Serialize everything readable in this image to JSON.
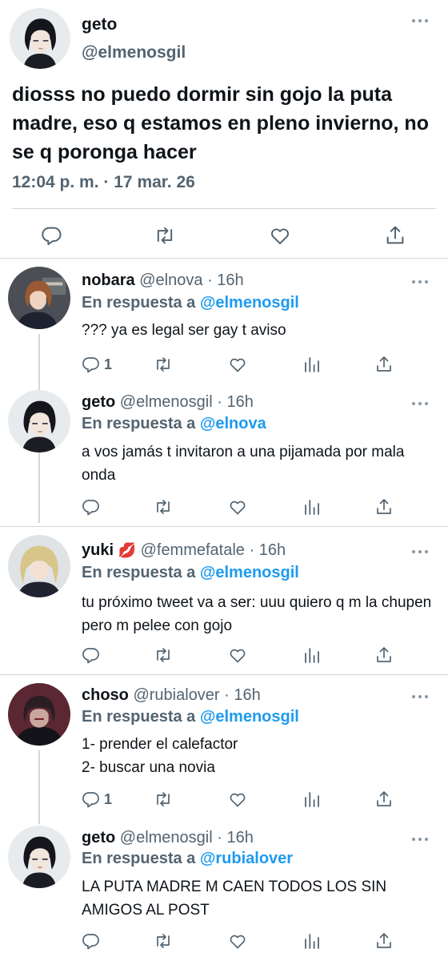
{
  "main_tweet": {
    "name": "geto",
    "handle": "@elmenosgil",
    "text": "diosss no puedo dormir sin gojo la puta madre, eso q estamos en pleno invierno, no se q poronga hacer",
    "time": "12:04 p. m.",
    "separator": "·",
    "date": "17 mar. 26"
  },
  "reply_prefix": "En respuesta a",
  "replies": [
    {
      "name": "nobara",
      "handle": "@elnova",
      "time": "16h",
      "to": "@elmenosgil",
      "text": "??? ya es legal ser gay t aviso",
      "reply_count": "1"
    },
    {
      "name": "geto",
      "handle": "@elmenosgil",
      "time": "16h",
      "to": "@elnova",
      "text": "a vos jamás t invitaron a una pijamada por mala onda",
      "reply_count": ""
    },
    {
      "name": "yuki",
      "name_emoji": "💋",
      "handle": "@femmefatale",
      "time": "16h",
      "to": "@elmenosgil",
      "text": "tu próximo tweet va a ser: uuu quiero q m la chupen pero m pelee con gojo",
      "reply_count": ""
    },
    {
      "name": "choso",
      "handle": "@rubialover",
      "time": "16h",
      "to": "@elmenosgil",
      "text_lines": [
        "1- prender el calefactor",
        "2- buscar una novia"
      ],
      "reply_count": "1"
    },
    {
      "name": "geto",
      "handle": "@elmenosgil",
      "time": "16h",
      "to": "@rubialover",
      "text": "LA PUTA MADRE M CAEN TODOS LOS SIN AMIGOS AL POST",
      "reply_count": ""
    }
  ],
  "colors": {
    "link": "#1d9bf0",
    "secondary_text": "#536471",
    "divider": "#cfd9de",
    "icon": "#536471"
  }
}
